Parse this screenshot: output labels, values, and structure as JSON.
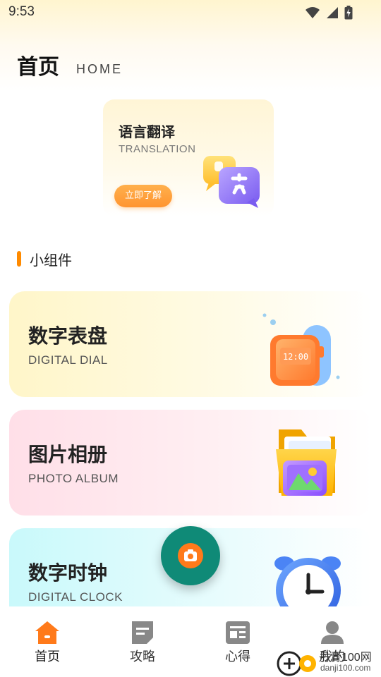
{
  "status_bar": {
    "time": "9:53",
    "icons": [
      "wifi-icon",
      "signal-icon",
      "battery-charging-icon"
    ]
  },
  "header": {
    "title": "首页",
    "subtitle": "HOME"
  },
  "banner": {
    "title": "语言翻译",
    "subtitle": "TRANSLATION",
    "button_label": "立即了解",
    "icon": "translate-bubbles-icon"
  },
  "section": {
    "title": "小组件"
  },
  "cards": [
    {
      "title": "数字表盘",
      "subtitle": "DIGITAL DIAL",
      "icon": "smartwatch-icon",
      "watch_time": "12:00"
    },
    {
      "title": "图片相册",
      "subtitle": "PHOTO ALBUM",
      "icon": "photo-folder-icon"
    },
    {
      "title": "数字时钟",
      "subtitle": "DIGITAL CLOCK",
      "icon": "alarm-clock-icon"
    }
  ],
  "fab": {
    "icon": "camera-icon"
  },
  "bottom_nav": {
    "items": [
      {
        "label": "首页",
        "icon": "home-icon",
        "active": true
      },
      {
        "label": "攻略",
        "icon": "guide-icon",
        "active": false
      },
      {
        "label": "心得",
        "icon": "notes-icon",
        "active": false
      },
      {
        "label": "我的",
        "icon": "profile-icon",
        "active": false
      }
    ]
  },
  "watermark": {
    "text": "丹青100网",
    "url": "danji100.com"
  },
  "colors": {
    "accent_orange": "#ff8a00",
    "fab_green": "#0f8a77",
    "dial_card": "#fff6c9",
    "album_card": "#ffdfe8",
    "clock_card": "#c9f9fb"
  }
}
